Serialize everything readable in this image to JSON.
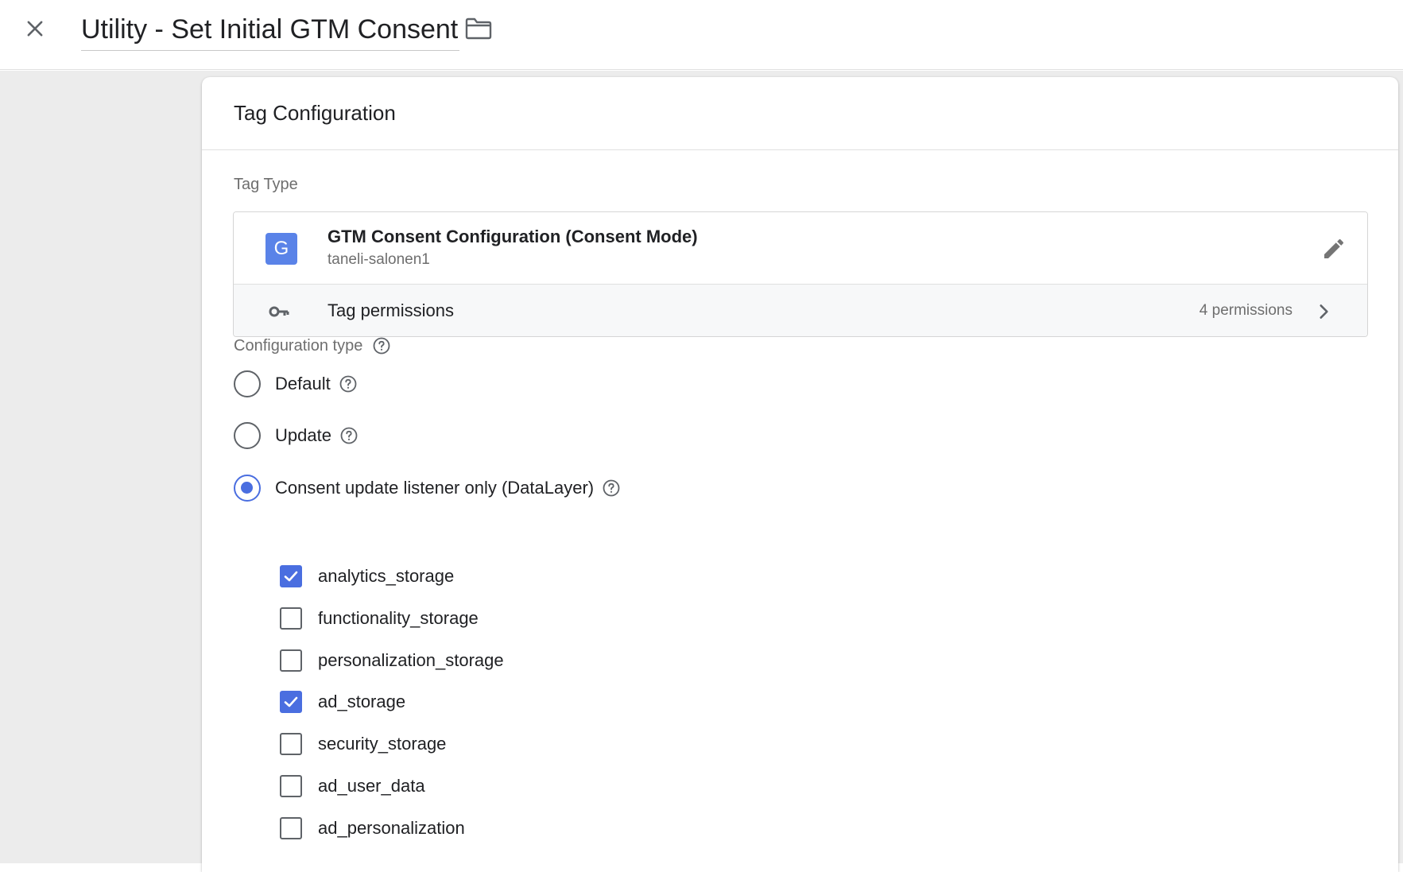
{
  "header": {
    "title": "Utility - Set Initial GTM Consent"
  },
  "card": {
    "title": "Tag Configuration",
    "tag_type_label": "Tag Type",
    "tag_type": {
      "name": "GTM Consent Configuration (Consent Mode)",
      "author": "taneli-salonen1",
      "icon_letter": "G",
      "icon_color": "#5a83e8"
    },
    "permissions": {
      "label": "Tag permissions",
      "count": "4 permissions"
    },
    "config_type_label": "Configuration type",
    "config_options": [
      {
        "label": "Default",
        "selected": false
      },
      {
        "label": "Update",
        "selected": false
      },
      {
        "label": "Consent update listener only (DataLayer)",
        "selected": true
      }
    ],
    "consent_types": [
      {
        "label": "analytics_storage",
        "checked": true
      },
      {
        "label": "functionality_storage",
        "checked": false
      },
      {
        "label": "personalization_storage",
        "checked": false
      },
      {
        "label": "ad_storage",
        "checked": true
      },
      {
        "label": "security_storage",
        "checked": false
      },
      {
        "label": "ad_user_data",
        "checked": false
      },
      {
        "label": "ad_personalization",
        "checked": false
      }
    ]
  },
  "colors": {
    "accent": "#4a6ee0",
    "background": "#ececec"
  }
}
